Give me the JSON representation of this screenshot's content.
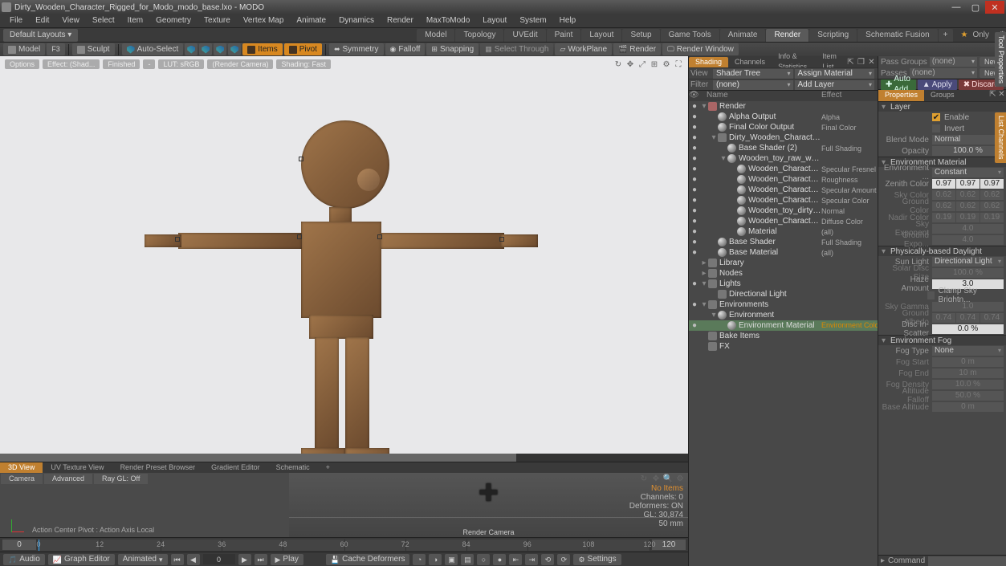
{
  "window": {
    "title": "Dirty_Wooden_Character_Rigged_for_Modo_modo_base.lxo - MODO",
    "min": "—",
    "max": "▢",
    "close": "✕"
  },
  "menu": [
    "File",
    "Edit",
    "View",
    "Select",
    "Item",
    "Geometry",
    "Texture",
    "Vertex Map",
    "Animate",
    "Dynamics",
    "Render",
    "MaxToModo",
    "Layout",
    "System",
    "Help"
  ],
  "layouts_btn": "Default Layouts ▾",
  "top_tabs": [
    "Model",
    "Topology",
    "UVEdit",
    "Paint",
    "Layout",
    "Setup",
    "Game Tools",
    "Animate",
    "Render",
    "Scripting",
    "Schematic Fusion"
  ],
  "top_tab_active": "Render",
  "only_label": "Only",
  "toolbar": {
    "model": "Model",
    "f3": "F3",
    "sculpt": "Sculpt",
    "auto_select": "Auto-Select",
    "items": "Items",
    "pivot": "Pivot",
    "symmetry": "Symmetry",
    "falloff": "Falloff",
    "snapping": "Snapping",
    "select_through": "Select Through",
    "workplane": "WorkPlane",
    "render": "Render",
    "render_window": "Render Window"
  },
  "viewport": {
    "tags": [
      "Options",
      "Effect: (Shad...",
      "Finished",
      "-",
      "LUT: sRGB",
      "(Render Camera)",
      "Shading: Fast"
    ],
    "icons": [
      "↻",
      "✥",
      "⤢",
      "⊞",
      "⚙",
      "⛶"
    ]
  },
  "shader_panel": {
    "tabs": [
      "Shading",
      "Channels",
      "Info & Statistics",
      "Item List"
    ],
    "view_lbl": "View",
    "view_val": "Shader Tree",
    "assign": "Assign Material",
    "filter_lbl": "Filter",
    "filter_val": "(none)",
    "add_layer": "Add Layer",
    "head_name": "Name",
    "head_effect": "Effect",
    "tree": [
      {
        "d": 0,
        "eye": "●",
        "tw": "▾",
        "icon": "cam",
        "label": "Render",
        "effect": ""
      },
      {
        "d": 1,
        "eye": "●",
        "tw": "",
        "icon": "ball",
        "label": "Alpha Output",
        "effect": "Alpha"
      },
      {
        "d": 1,
        "eye": "●",
        "tw": "",
        "icon": "ball",
        "label": "Final Color Output",
        "effect": "Final Color"
      },
      {
        "d": 1,
        "eye": "●",
        "tw": "▾",
        "icon": "",
        "label": "Dirty_Wooden_Character_R...",
        "effect": ""
      },
      {
        "d": 2,
        "eye": "●",
        "tw": "",
        "icon": "ball",
        "label": "Base Shader (2)",
        "effect": "Full Shading"
      },
      {
        "d": 2,
        "eye": "●",
        "tw": "▾",
        "icon": "ball",
        "label": "Wooden_toy_raw_wood (...",
        "effect": ""
      },
      {
        "d": 3,
        "eye": "●",
        "tw": "",
        "icon": "ball",
        "label": "Wooden_Character_Dir...",
        "effect": "Specular Fresnel"
      },
      {
        "d": 3,
        "eye": "●",
        "tw": "",
        "icon": "ball",
        "label": "Wooden_Character_Dir...",
        "effect": "Roughness"
      },
      {
        "d": 3,
        "eye": "●",
        "tw": "",
        "icon": "ball",
        "label": "Wooden_Character_Dir...",
        "effect": "Specular Amount"
      },
      {
        "d": 3,
        "eye": "●",
        "tw": "",
        "icon": "ball",
        "label": "Wooden_Character_Dir...",
        "effect": "Specular Color"
      },
      {
        "d": 3,
        "eye": "●",
        "tw": "",
        "icon": "ball",
        "label": "Wooden_toy_dirty_bu ...",
        "effect": "Normal"
      },
      {
        "d": 3,
        "eye": "●",
        "tw": "",
        "icon": "ball",
        "label": "Wooden_Character_Dir...",
        "effect": "Diffuse Color"
      },
      {
        "d": 3,
        "eye": "●",
        "tw": "",
        "icon": "ball",
        "label": "Material",
        "effect": "(all)"
      },
      {
        "d": 1,
        "eye": "●",
        "tw": "",
        "icon": "ball",
        "label": "Base Shader",
        "effect": "Full Shading"
      },
      {
        "d": 1,
        "eye": "●",
        "tw": "",
        "icon": "ball",
        "label": "Base Material",
        "effect": "(all)"
      },
      {
        "d": 0,
        "eye": "",
        "tw": "▸",
        "icon": "",
        "label": "Library",
        "effect": ""
      },
      {
        "d": 0,
        "eye": "",
        "tw": "▸",
        "icon": "",
        "label": "Nodes",
        "effect": ""
      },
      {
        "d": 0,
        "eye": "●",
        "tw": "▾",
        "icon": "",
        "label": "Lights",
        "effect": ""
      },
      {
        "d": 1,
        "eye": "",
        "tw": "",
        "icon": "",
        "label": "Directional Light",
        "effect": ""
      },
      {
        "d": 0,
        "eye": "●",
        "tw": "▾",
        "icon": "",
        "label": "Environments",
        "effect": ""
      },
      {
        "d": 1,
        "eye": "",
        "tw": "▾",
        "icon": "ball",
        "label": "Environment",
        "effect": ""
      },
      {
        "d": 2,
        "eye": "●",
        "tw": "",
        "icon": "ball",
        "label": "Environment Material",
        "effect": "Environment Color ▾",
        "sel": true
      },
      {
        "d": 0,
        "eye": "",
        "tw": "",
        "icon": "",
        "label": "Bake Items",
        "effect": ""
      },
      {
        "d": 0,
        "eye": "",
        "tw": "",
        "icon": "",
        "label": "FX",
        "effect": ""
      }
    ]
  },
  "props": {
    "passgroups_lbl": "Pass Groups",
    "passgroups_val": "(none)",
    "new": "New",
    "passes_lbl": "Passes",
    "passes_val": "(none)",
    "autoadd": "Auto Add",
    "apply": "Apply",
    "discard": "Discard",
    "tabs": [
      "Properties",
      "Groups"
    ],
    "layer": "Layer",
    "enable_lbl": "Enable",
    "invert_lbl": "Invert",
    "blend_lbl": "Blend Mode",
    "blend_val": "Normal",
    "opacity_lbl": "Opacity",
    "opacity_val": "100.0 %",
    "envmat": "Environment Material",
    "envtype_lbl": "Environment ...",
    "envtype_val": "Constant",
    "zenith_lbl": "Zenith Color",
    "zenith": [
      "0.97",
      "0.97",
      "0.97"
    ],
    "sky_lbl": "Sky Color",
    "sky": [
      "0.62",
      "0.62",
      "0.62"
    ],
    "ground_lbl": "Ground Color",
    "ground": [
      "0.62",
      "0.62",
      "0.62"
    ],
    "nadir_lbl": "Nadir Color",
    "nadir": [
      "0.19",
      "0.19",
      "0.19"
    ],
    "skyexp_lbl": "Sky Exponent",
    "skyexp": "4.0",
    "groundexp_lbl": "Ground Expo...",
    "groundexp": "4.0",
    "daylight": "Physically-based Daylight",
    "sunlight_lbl": "Sun Light",
    "sunlight_val": "Directional Light",
    "solar_lbl": "Solar Disc Size",
    "solar_val": "100.0 %",
    "haze_lbl": "Haze Amount",
    "haze_val": "3.0",
    "clamp_lbl": "Clamp Sky Brightn...",
    "gamma_lbl": "Sky Gamma",
    "gamma_val": "1.0",
    "albedo_lbl": "Ground Albedo",
    "albedo": [
      "0.74",
      "0.74",
      "0.74"
    ],
    "scatter_lbl": "Disc In-Scatter",
    "scatter_val": "0.0 %",
    "fog": "Environment Fog",
    "fogtype_lbl": "Fog Type",
    "fogtype_val": "None",
    "fogstart_lbl": "Fog Start",
    "fogstart_val": "0 m",
    "fogend_lbl": "Fog End",
    "fogend_val": "10 m",
    "fogdensity_lbl": "Fog Density",
    "fogdensity_val": "10.0 %",
    "altfalloff_lbl": "Altitude Falloff",
    "altfalloff_val": "50.0 %",
    "basealt_lbl": "Base Altitude",
    "basealt_val": "0 m",
    "command_lbl": "Command"
  },
  "lower_tabs": [
    "3D View",
    "UV Texture View",
    "Render Preset Browser",
    "Gradient Editor",
    "Schematic",
    "+"
  ],
  "lower": {
    "camera": "Camera",
    "advanced": "Advanced",
    "raygl": "Ray GL: Off",
    "action_center": "Action Center Pivot : Action Axis Local",
    "rendercam": "Render Camera",
    "stats": {
      "noitems": "No Items",
      "channels": "Channels: 0",
      "deformers": "Deformers: ON",
      "gl": "GL: 30,874",
      "focal": "50 mm"
    }
  },
  "timeline": {
    "start": "0",
    "end": "120",
    "ticks": [
      0,
      12,
      24,
      36,
      48,
      60,
      72,
      84,
      96,
      108,
      120
    ]
  },
  "playbar": {
    "audio": "Audio",
    "graph": "Graph Editor",
    "mode": "Animated",
    "cur": "0",
    "play": "Play",
    "cache": "Cache Deformers",
    "settings": "Settings"
  },
  "side_vert": {
    "a": "Tool Properties",
    "b": "List Channels"
  }
}
